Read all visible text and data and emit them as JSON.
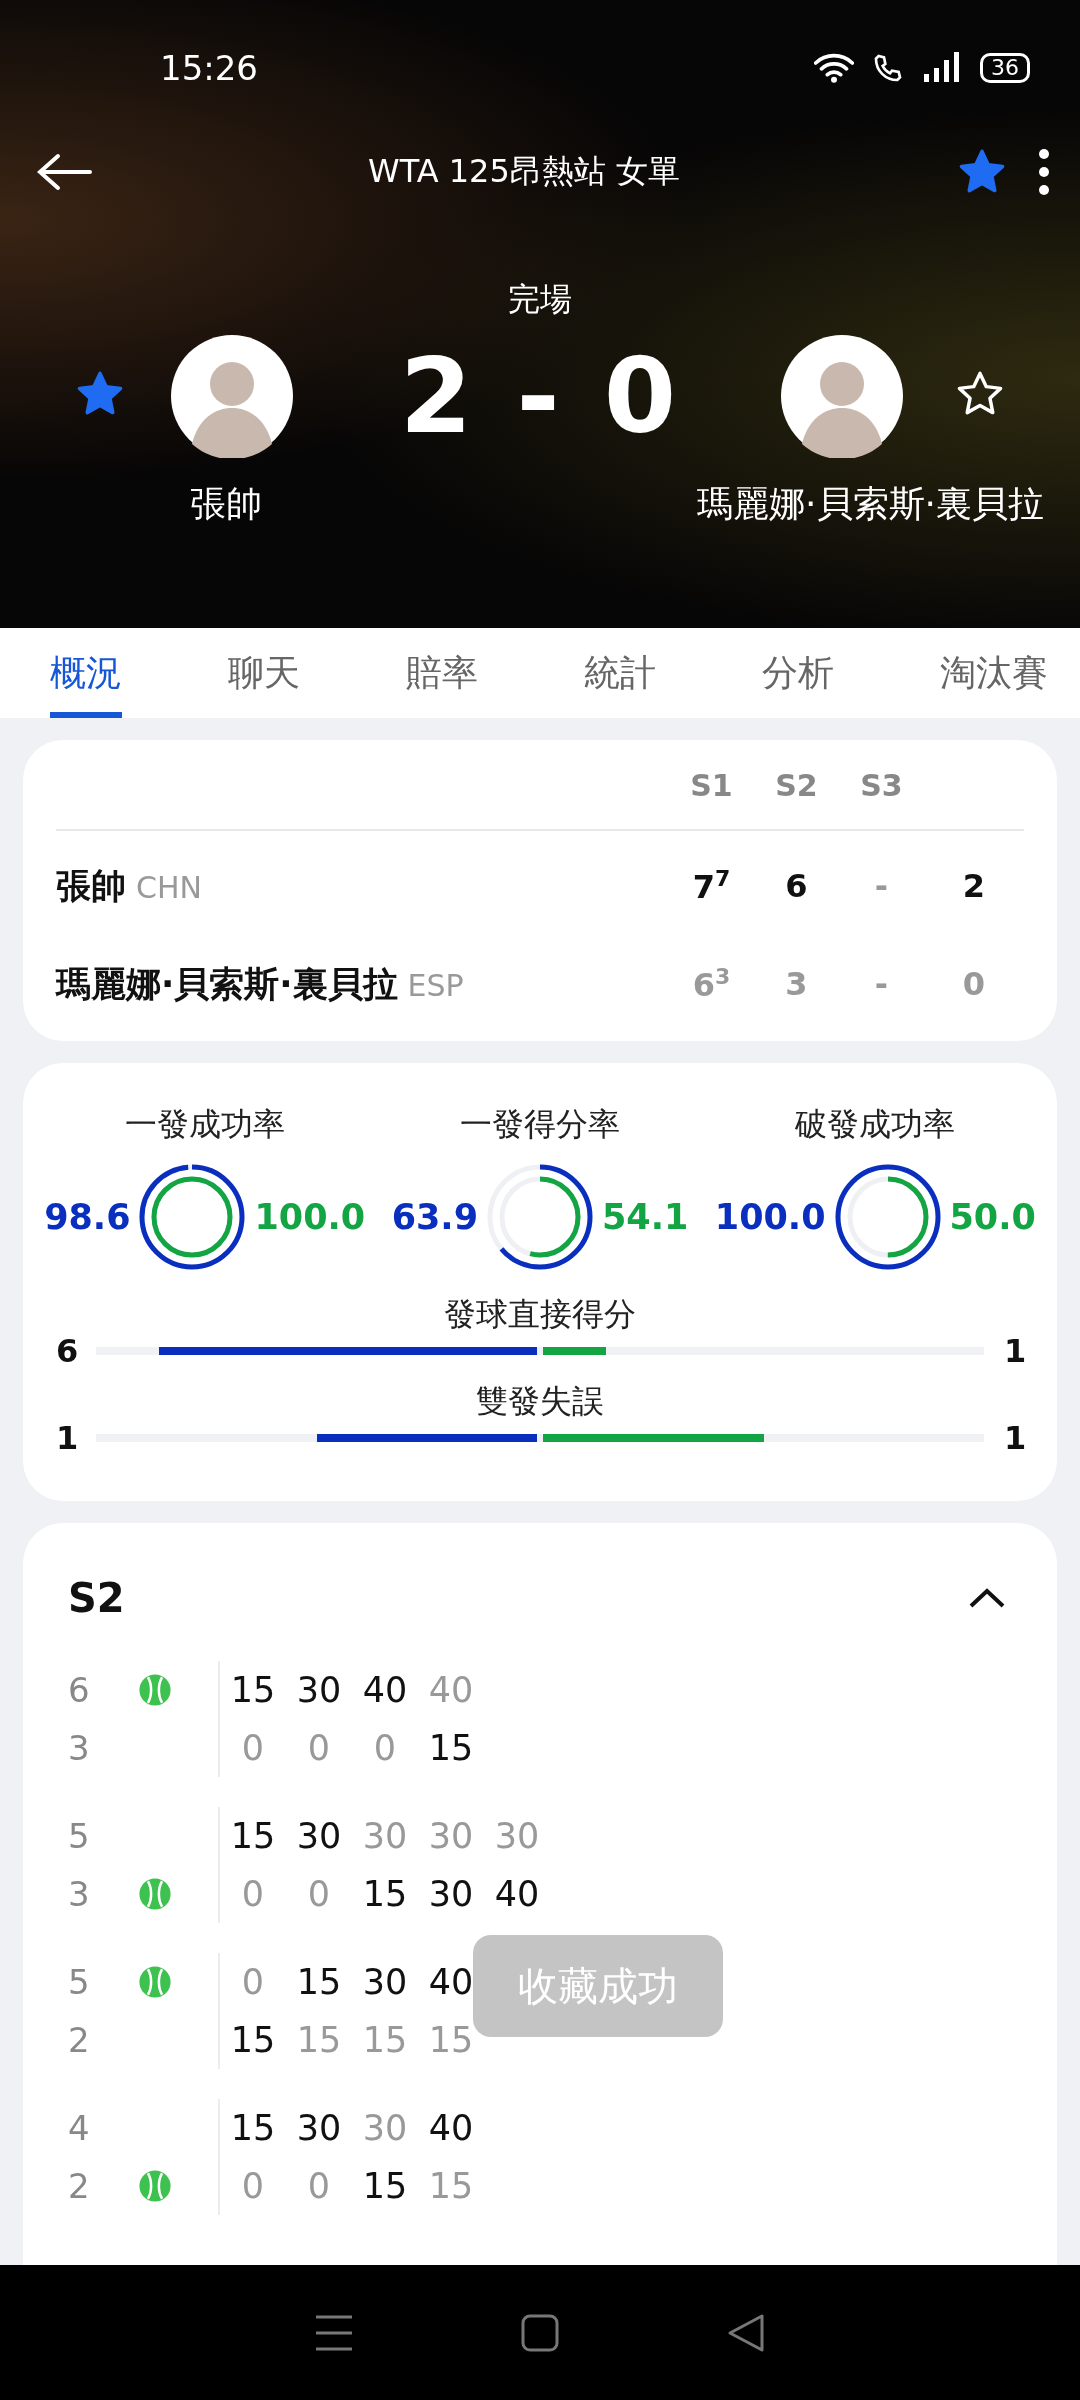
{
  "status_bar": {
    "time": "15:26",
    "battery": "36"
  },
  "header": {
    "title": "WTA 125昂熱站 女單",
    "favorited": true,
    "match_status": "完場",
    "score": "2 - 0",
    "players": [
      {
        "name": "張帥",
        "favorited": true
      },
      {
        "name": "瑪麗娜·貝索斯·裏貝拉",
        "favorited": false
      }
    ]
  },
  "tabs": [
    {
      "label": "概況",
      "selected": true
    },
    {
      "label": "聊天",
      "selected": false
    },
    {
      "label": "賠率",
      "selected": false
    },
    {
      "label": "統計",
      "selected": false
    },
    {
      "label": "分析",
      "selected": false
    },
    {
      "label": "淘汰賽",
      "selected": false
    }
  ],
  "scoreboard": {
    "columns": [
      "S1",
      "S2",
      "S3"
    ],
    "rows": [
      {
        "name": "張帥",
        "country": "CHN",
        "winner": true,
        "sets": [
          {
            "score": "7",
            "tiebreak": "7",
            "won": true
          },
          {
            "score": "6",
            "won": true
          },
          {
            "score": "-",
            "won": false
          }
        ],
        "total": "2"
      },
      {
        "name": "瑪麗娜·貝索斯·裏貝拉",
        "country": "ESP",
        "winner": false,
        "sets": [
          {
            "score": "6",
            "tiebreak": "3",
            "won": false
          },
          {
            "score": "3",
            "won": false
          },
          {
            "score": "-",
            "won": false
          }
        ],
        "total": "0"
      }
    ]
  },
  "stats": {
    "rings": [
      {
        "label": "一發成功率",
        "home": {
          "value": "98.6",
          "level": 0.986
        },
        "away": {
          "value": "100.0",
          "level": 1.0
        }
      },
      {
        "label": "一發得分率",
        "home": {
          "value": "63.9",
          "level": 0.639
        },
        "away": {
          "value": "54.1",
          "level": 0.541
        }
      },
      {
        "label": "破發成功率",
        "home": {
          "value": "100.0",
          "level": 1.0
        },
        "away": {
          "value": "50.0",
          "level": 0.5
        }
      }
    ],
    "bars": [
      {
        "label": "發球直接得分",
        "home": {
          "value": "6"
        },
        "away": {
          "value": "1"
        }
      },
      {
        "label": "雙發失誤",
        "home": {
          "value": "1"
        },
        "away": {
          "value": "1"
        }
      }
    ]
  },
  "set_detail": {
    "title": "S2",
    "expanded": true,
    "games": [
      {
        "home_games": "6",
        "away_games": "3",
        "home_serving": true,
        "points": [
          {
            "home": "15",
            "away": "0",
            "home_won": true
          },
          {
            "home": "30",
            "away": "0",
            "home_won": true
          },
          {
            "home": "40",
            "away": "0",
            "home_won": true
          },
          {
            "home": "40",
            "away": "15",
            "home_won": false
          }
        ]
      },
      {
        "home_games": "5",
        "away_games": "3",
        "home_serving": false,
        "points": [
          {
            "home": "15",
            "away": "0",
            "home_won": true
          },
          {
            "home": "30",
            "away": "0",
            "home_won": true
          },
          {
            "home": "30",
            "away": "15",
            "home_won": false
          },
          {
            "home": "30",
            "away": "30",
            "home_won": false
          },
          {
            "home": "30",
            "away": "40",
            "home_won": false
          }
        ]
      },
      {
        "home_games": "5",
        "away_games": "2",
        "home_serving": true,
        "points": [
          {
            "home": "0",
            "away": "15",
            "home_won": false
          },
          {
            "home": "15",
            "away": "15",
            "home_won": true
          },
          {
            "home": "30",
            "away": "15",
            "home_won": true
          },
          {
            "home": "40",
            "away": "15",
            "home_won": true
          }
        ]
      },
      {
        "home_games": "4",
        "away_games": "2",
        "home_serving": false,
        "points": [
          {
            "home": "15",
            "away": "0",
            "home_won": true
          },
          {
            "home": "30",
            "away": "0",
            "home_won": true
          },
          {
            "home": "30",
            "away": "15",
            "home_won": false
          },
          {
            "home": "40",
            "away": "15",
            "home_won": true
          }
        ]
      }
    ]
  },
  "toast": "收藏成功"
}
